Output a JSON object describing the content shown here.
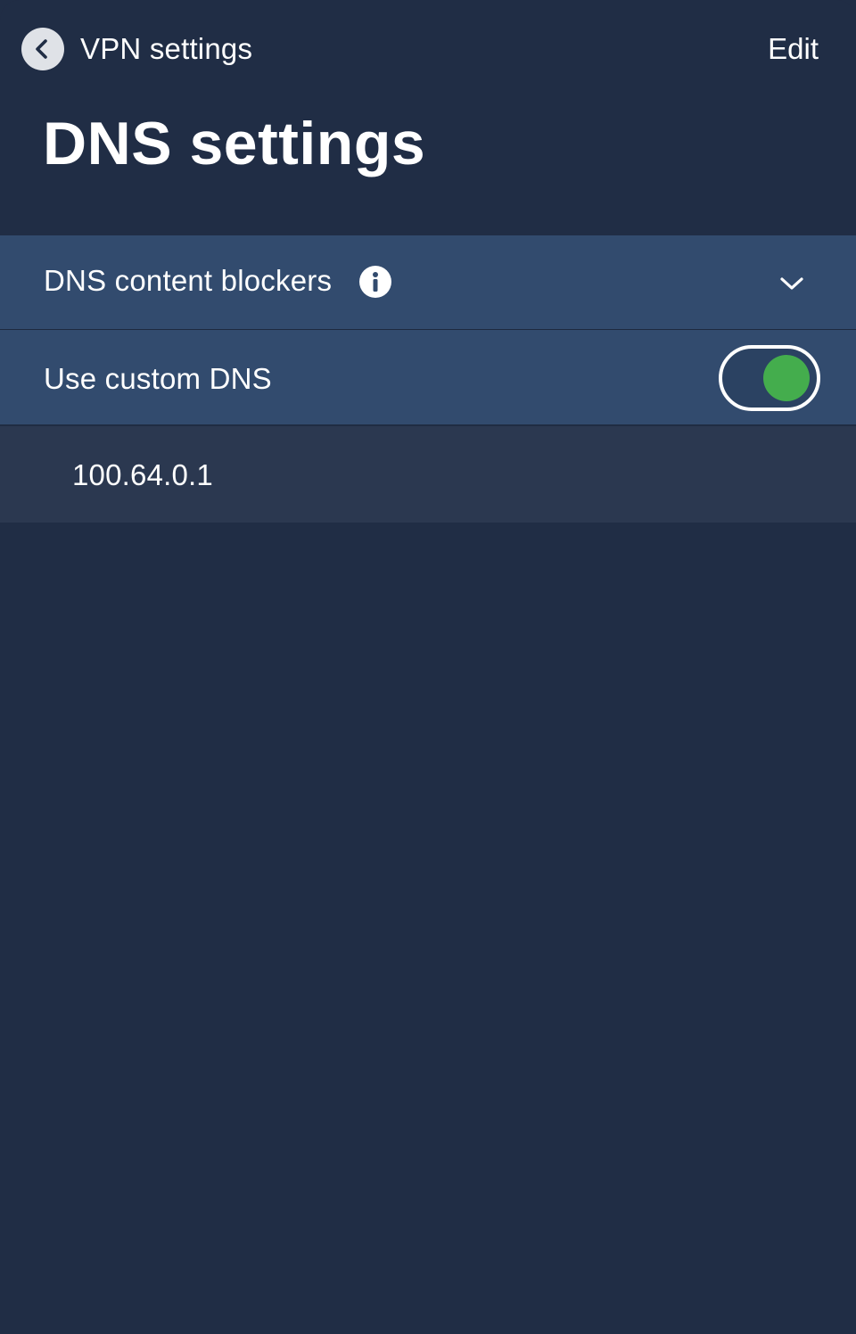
{
  "navbar": {
    "back_label": "VPN settings",
    "edit_label": "Edit"
  },
  "title": "DNS settings",
  "sections": {
    "content_blockers": {
      "label": "DNS content blockers",
      "info_icon": "info-icon",
      "expand_icon": "chevron-down-icon",
      "expanded": false
    },
    "custom_dns": {
      "label": "Use custom DNS",
      "enabled": true
    }
  },
  "dns_servers": [
    "100.64.0.1"
  ],
  "colors": {
    "background": "#202d45",
    "row": "#324b6e",
    "entry": "#2b3850",
    "toggle_on": "#44ad4d",
    "back_circle": "#dfe2e7"
  }
}
